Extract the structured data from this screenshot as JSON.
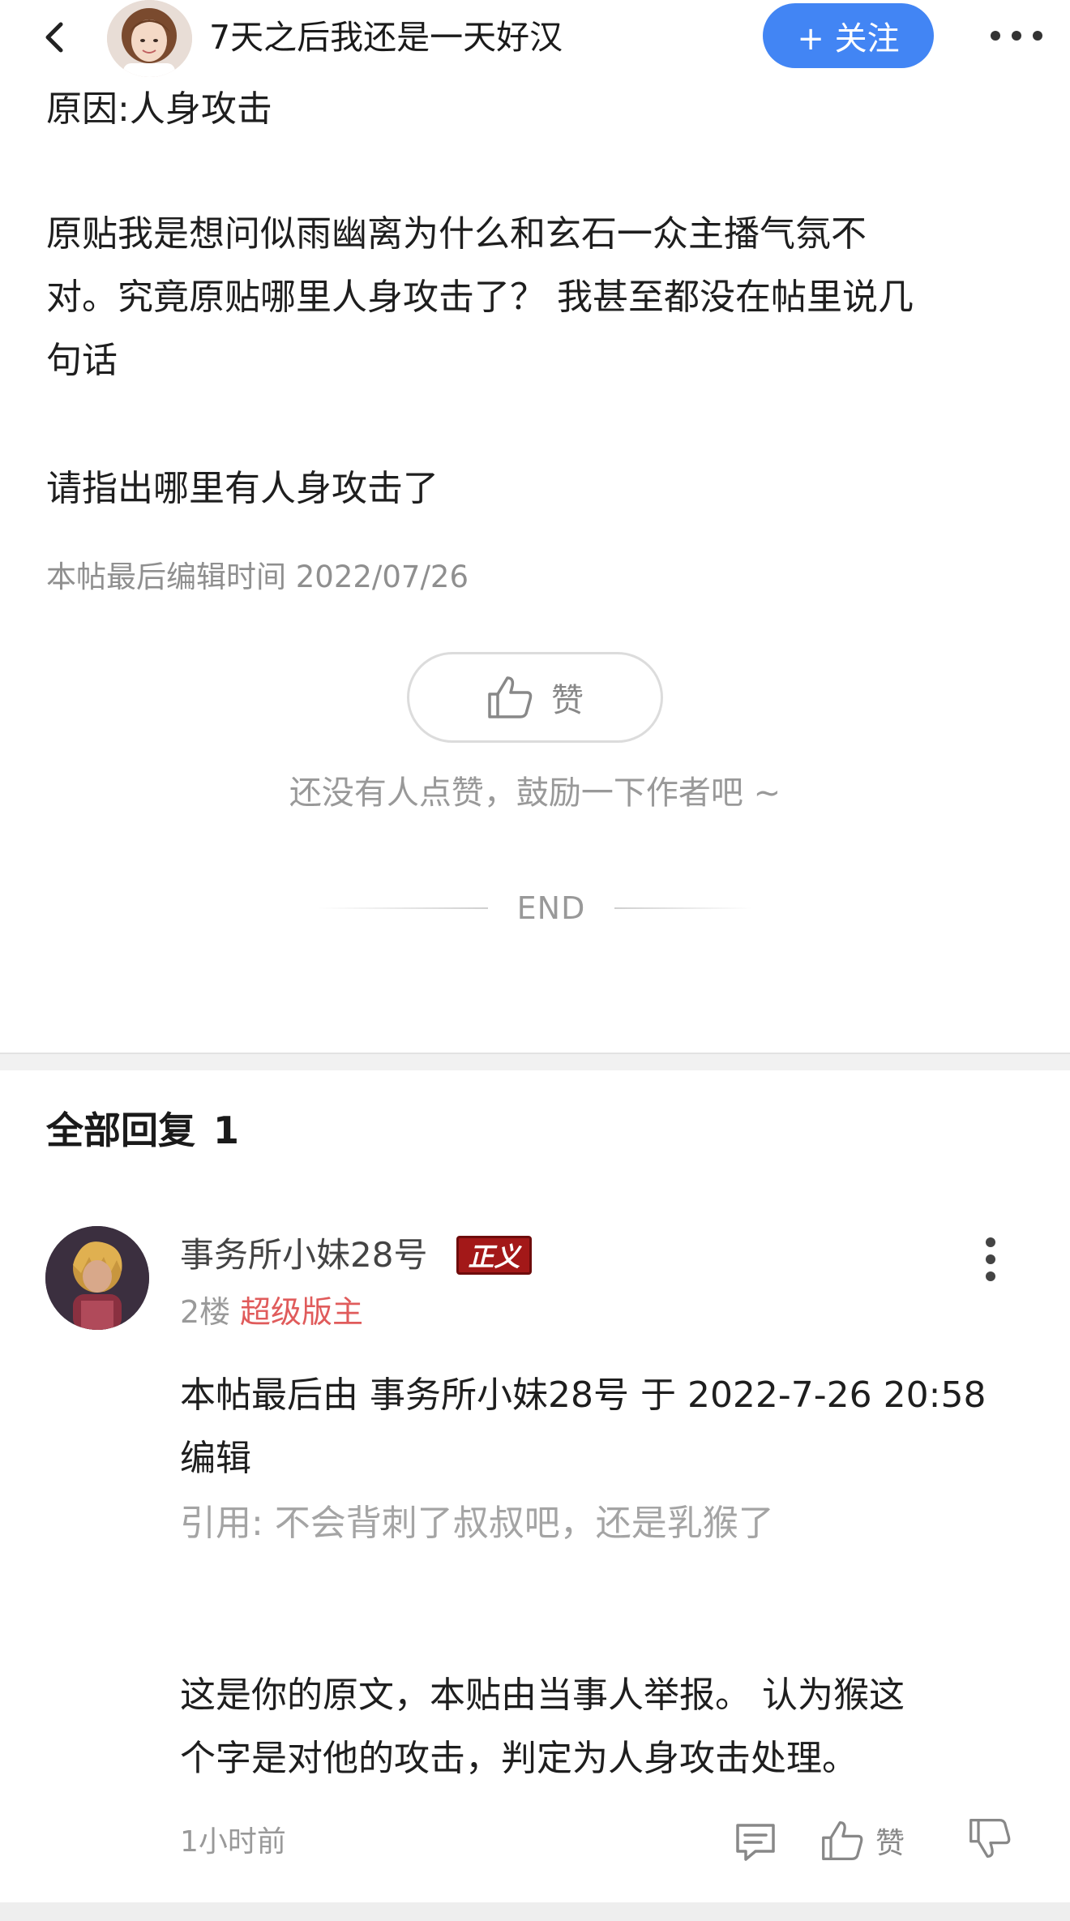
{
  "header": {
    "back_icon": "chevron-left-icon",
    "author_name": "7天之后我还是一天好汉",
    "follow_label": "+ 关注",
    "more_icon": "horizontal-dots-icon",
    "accent_color": "#4285f4"
  },
  "post": {
    "lines": [
      "原因:人身攻击",
      "原贴我是想问似雨幽离为什么和玄石一众主播气氛不",
      "对。究竟原贴哪里人身攻击了？ 我甚至都没在帖里说几",
      "句话",
      "请指出哪里有人身攻击了"
    ],
    "edit_time": "本帖最后编辑时间 2022/07/26",
    "like_label": "赞",
    "like_hint": "还没有人点赞，鼓励一下作者吧 ~",
    "end_label": "END"
  },
  "replies": {
    "title": "全部回复",
    "count": "1",
    "items": [
      {
        "username": "事务所小妹28号",
        "badge": "正义",
        "floor": "2楼",
        "role": "超级版主",
        "body_lines": [
          "本帖最后由 事务所小妹28号 于 2022-7-26 20:58",
          "编辑"
        ],
        "quote": "引用: 不会背刺了叔叔吧，还是乳猴了",
        "text_lines": [
          "这是你的原文，本贴由当事人举报。 认为猴这",
          "个字是对他的攻击，判定为人身攻击处理。"
        ],
        "time": "1小时前",
        "like_label": "赞"
      }
    ]
  }
}
